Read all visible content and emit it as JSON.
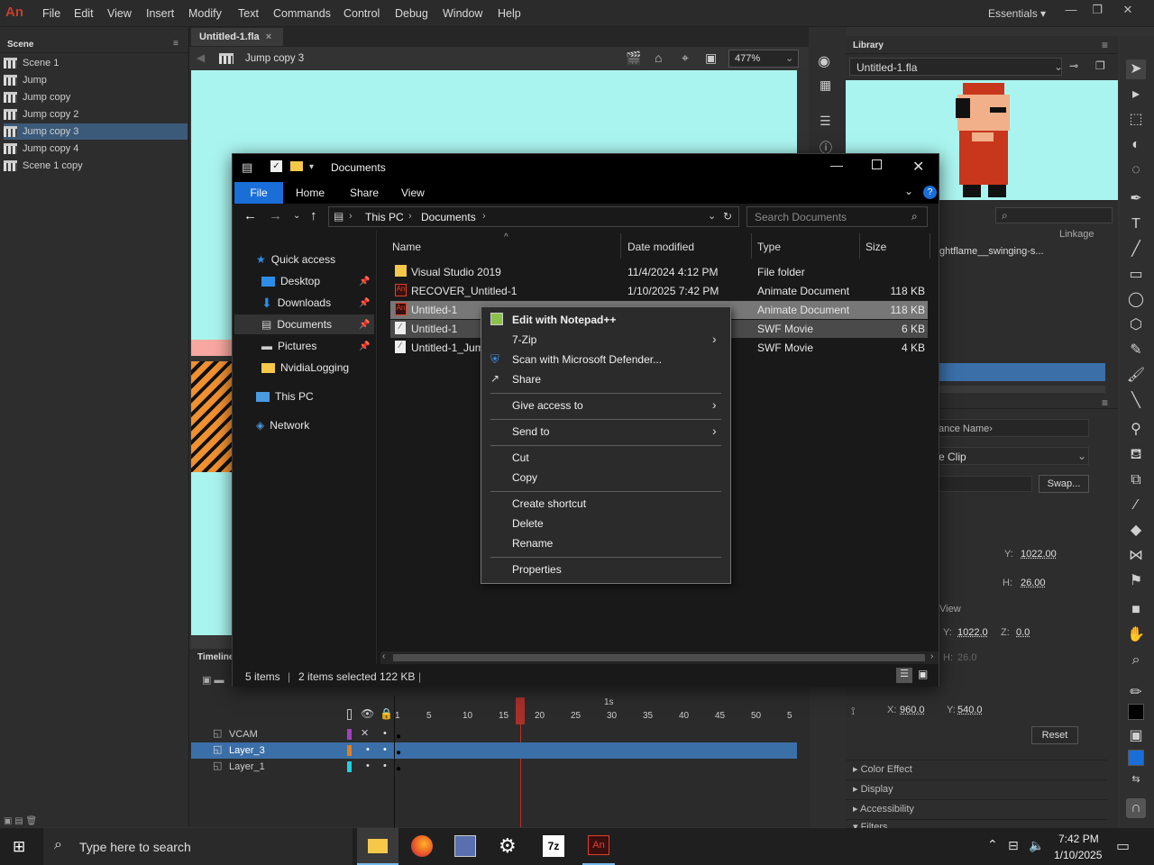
{
  "app": {
    "logo": "An",
    "menu": [
      "File",
      "Edit",
      "View",
      "Insert",
      "Modify",
      "Text",
      "Commands",
      "Control",
      "Debug",
      "Window",
      "Help"
    ],
    "workspace": "Essentials"
  },
  "scene_panel": {
    "title": "Scene",
    "items": [
      "Scene 1",
      "Jump",
      "Jump copy",
      "Jump copy 2",
      "Jump copy 3",
      "Jump copy 4",
      "Scene 1 copy"
    ],
    "selected": 4
  },
  "doc": {
    "tab": "Untitled-1.fla",
    "tab_close": "×",
    "breadcrumb": "Jump copy 3",
    "zoom": "477%"
  },
  "library": {
    "title": "Library",
    "file": "Untitled-1.fla",
    "col_linkage": "Linkage",
    "item": "ghtflame__swinging-s..."
  },
  "properties": {
    "instance_name": "ance Name›",
    "type": "e Clip",
    "swap": "Swap...",
    "y": "1022.00",
    "h": "26.00",
    "view_label": "View",
    "y2": "1022.0",
    "z": "0.0",
    "h2": "26.0",
    "x3": "960.0",
    "y3": "540.0",
    "reset": "Reset",
    "sections": [
      "Color Effect",
      "Display",
      "Accessibility",
      "Filters"
    ],
    "labels": {
      "y": "Y:",
      "h": "H:",
      "z": "Z:",
      "x": "X:"
    }
  },
  "timeline": {
    "title": "Timeline",
    "frames": [
      "1",
      "5",
      "10",
      "15",
      "20",
      "25",
      "30",
      "35",
      "40",
      "45",
      "50",
      "5"
    ],
    "sec": "1s",
    "layers": [
      {
        "name": "VCAM",
        "color": "#a040c0"
      },
      {
        "name": "Layer_3",
        "color": "#e08020"
      },
      {
        "name": "Layer_1",
        "color": "#20d0e0"
      }
    ]
  },
  "explorer": {
    "title": "Documents",
    "ribbon": [
      "File",
      "Home",
      "Share",
      "View"
    ],
    "address": [
      "This PC",
      "Documents"
    ],
    "search_placeholder": "Search Documents",
    "nav": [
      {
        "label": "Quick access",
        "pinned": false
      },
      {
        "label": "Desktop",
        "pinned": true
      },
      {
        "label": "Downloads",
        "pinned": true
      },
      {
        "label": "Documents",
        "pinned": true
      },
      {
        "label": "Pictures",
        "pinned": true
      },
      {
        "label": "NvidiaLogging",
        "pinned": false
      },
      {
        "label": "This PC",
        "pinned": false
      },
      {
        "label": "Network",
        "pinned": false
      }
    ],
    "columns": [
      "Name",
      "Date modified",
      "Type",
      "Size"
    ],
    "files": [
      {
        "name": "Visual Studio 2019",
        "date": "11/4/2024 4:12 PM",
        "type": "File folder",
        "size": ""
      },
      {
        "name": "RECOVER_Untitled-1",
        "date": "1/10/2025 7:42 PM",
        "type": "Animate Document",
        "size": "118 KB"
      },
      {
        "name": "Untitled-1",
        "date": "",
        "type": "Animate Document",
        "size": "118 KB"
      },
      {
        "name": "Untitled-1",
        "date": "",
        "type": "SWF Movie",
        "size": "6 KB"
      },
      {
        "name": "Untitled-1_Jum",
        "date": "",
        "type": "SWF Movie",
        "size": "4 KB"
      }
    ],
    "status_items": "5 items",
    "status_selected": "2 items selected",
    "status_size": "122 KB"
  },
  "context_menu": [
    "Edit with Notepad++",
    "7-Zip",
    "Scan with Microsoft Defender...",
    "Share",
    "Give access to",
    "Send to",
    "Cut",
    "Copy",
    "Create shortcut",
    "Delete",
    "Rename",
    "Properties"
  ],
  "taskbar": {
    "search": "Type here to search",
    "time": "7:42 PM",
    "date": "1/10/2025"
  }
}
